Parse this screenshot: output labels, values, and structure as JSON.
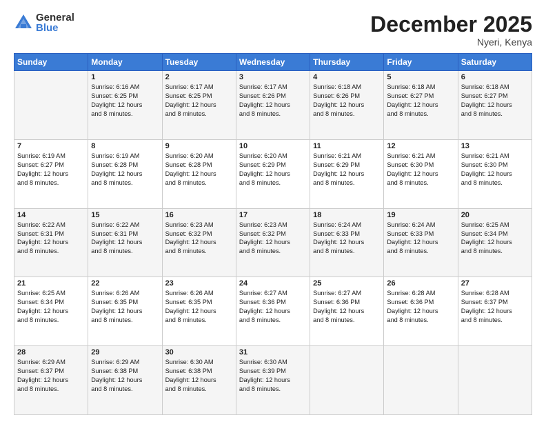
{
  "logo": {
    "general": "General",
    "blue": "Blue"
  },
  "title": "December 2025",
  "location": "Nyeri, Kenya",
  "days_of_week": [
    "Sunday",
    "Monday",
    "Tuesday",
    "Wednesday",
    "Thursday",
    "Friday",
    "Saturday"
  ],
  "weeks": [
    [
      {
        "day": "",
        "info": ""
      },
      {
        "day": "1",
        "info": "Sunrise: 6:16 AM\nSunset: 6:25 PM\nDaylight: 12 hours\nand 8 minutes."
      },
      {
        "day": "2",
        "info": "Sunrise: 6:17 AM\nSunset: 6:25 PM\nDaylight: 12 hours\nand 8 minutes."
      },
      {
        "day": "3",
        "info": "Sunrise: 6:17 AM\nSunset: 6:26 PM\nDaylight: 12 hours\nand 8 minutes."
      },
      {
        "day": "4",
        "info": "Sunrise: 6:18 AM\nSunset: 6:26 PM\nDaylight: 12 hours\nand 8 minutes."
      },
      {
        "day": "5",
        "info": "Sunrise: 6:18 AM\nSunset: 6:27 PM\nDaylight: 12 hours\nand 8 minutes."
      },
      {
        "day": "6",
        "info": "Sunrise: 6:18 AM\nSunset: 6:27 PM\nDaylight: 12 hours\nand 8 minutes."
      }
    ],
    [
      {
        "day": "7",
        "info": "Sunrise: 6:19 AM\nSunset: 6:27 PM\nDaylight: 12 hours\nand 8 minutes."
      },
      {
        "day": "8",
        "info": "Sunrise: 6:19 AM\nSunset: 6:28 PM\nDaylight: 12 hours\nand 8 minutes."
      },
      {
        "day": "9",
        "info": "Sunrise: 6:20 AM\nSunset: 6:28 PM\nDaylight: 12 hours\nand 8 minutes."
      },
      {
        "day": "10",
        "info": "Sunrise: 6:20 AM\nSunset: 6:29 PM\nDaylight: 12 hours\nand 8 minutes."
      },
      {
        "day": "11",
        "info": "Sunrise: 6:21 AM\nSunset: 6:29 PM\nDaylight: 12 hours\nand 8 minutes."
      },
      {
        "day": "12",
        "info": "Sunrise: 6:21 AM\nSunset: 6:30 PM\nDaylight: 12 hours\nand 8 minutes."
      },
      {
        "day": "13",
        "info": "Sunrise: 6:21 AM\nSunset: 6:30 PM\nDaylight: 12 hours\nand 8 minutes."
      }
    ],
    [
      {
        "day": "14",
        "info": "Sunrise: 6:22 AM\nSunset: 6:31 PM\nDaylight: 12 hours\nand 8 minutes."
      },
      {
        "day": "15",
        "info": "Sunrise: 6:22 AM\nSunset: 6:31 PM\nDaylight: 12 hours\nand 8 minutes."
      },
      {
        "day": "16",
        "info": "Sunrise: 6:23 AM\nSunset: 6:32 PM\nDaylight: 12 hours\nand 8 minutes."
      },
      {
        "day": "17",
        "info": "Sunrise: 6:23 AM\nSunset: 6:32 PM\nDaylight: 12 hours\nand 8 minutes."
      },
      {
        "day": "18",
        "info": "Sunrise: 6:24 AM\nSunset: 6:33 PM\nDaylight: 12 hours\nand 8 minutes."
      },
      {
        "day": "19",
        "info": "Sunrise: 6:24 AM\nSunset: 6:33 PM\nDaylight: 12 hours\nand 8 minutes."
      },
      {
        "day": "20",
        "info": "Sunrise: 6:25 AM\nSunset: 6:34 PM\nDaylight: 12 hours\nand 8 minutes."
      }
    ],
    [
      {
        "day": "21",
        "info": "Sunrise: 6:25 AM\nSunset: 6:34 PM\nDaylight: 12 hours\nand 8 minutes."
      },
      {
        "day": "22",
        "info": "Sunrise: 6:26 AM\nSunset: 6:35 PM\nDaylight: 12 hours\nand 8 minutes."
      },
      {
        "day": "23",
        "info": "Sunrise: 6:26 AM\nSunset: 6:35 PM\nDaylight: 12 hours\nand 8 minutes."
      },
      {
        "day": "24",
        "info": "Sunrise: 6:27 AM\nSunset: 6:36 PM\nDaylight: 12 hours\nand 8 minutes."
      },
      {
        "day": "25",
        "info": "Sunrise: 6:27 AM\nSunset: 6:36 PM\nDaylight: 12 hours\nand 8 minutes."
      },
      {
        "day": "26",
        "info": "Sunrise: 6:28 AM\nSunset: 6:36 PM\nDaylight: 12 hours\nand 8 minutes."
      },
      {
        "day": "27",
        "info": "Sunrise: 6:28 AM\nSunset: 6:37 PM\nDaylight: 12 hours\nand 8 minutes."
      }
    ],
    [
      {
        "day": "28",
        "info": "Sunrise: 6:29 AM\nSunset: 6:37 PM\nDaylight: 12 hours\nand 8 minutes."
      },
      {
        "day": "29",
        "info": "Sunrise: 6:29 AM\nSunset: 6:38 PM\nDaylight: 12 hours\nand 8 minutes."
      },
      {
        "day": "30",
        "info": "Sunrise: 6:30 AM\nSunset: 6:38 PM\nDaylight: 12 hours\nand 8 minutes."
      },
      {
        "day": "31",
        "info": "Sunrise: 6:30 AM\nSunset: 6:39 PM\nDaylight: 12 hours\nand 8 minutes."
      },
      {
        "day": "",
        "info": ""
      },
      {
        "day": "",
        "info": ""
      },
      {
        "day": "",
        "info": ""
      }
    ]
  ]
}
